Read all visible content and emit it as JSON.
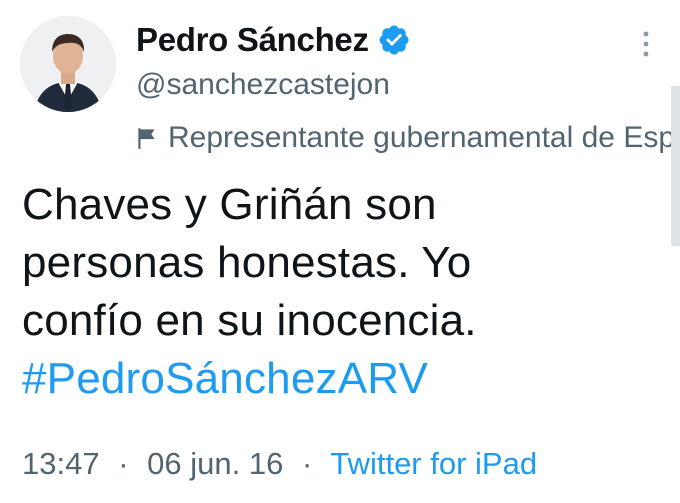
{
  "author": {
    "display_name": "Pedro Sánchez",
    "handle": "@sanchezcastejon",
    "verified": true,
    "label": "Representante gubernamental de España"
  },
  "tweet": {
    "lines": [
      "Chaves y Griñán son",
      "personas honestas. Yo",
      "confío en su inocencia."
    ],
    "hashtag": "#PedroSánchezARV",
    "time": "13:47",
    "separator": "·",
    "date": "06 jun. 16",
    "source": "Twitter for iPad"
  },
  "colors": {
    "link": "#1d9bf0",
    "secondary_text": "#536471",
    "primary_text": "#0f1419"
  },
  "icons": {
    "verified": "verified-badge-icon",
    "label": "flag-icon",
    "more": "more-vertical-icon"
  }
}
